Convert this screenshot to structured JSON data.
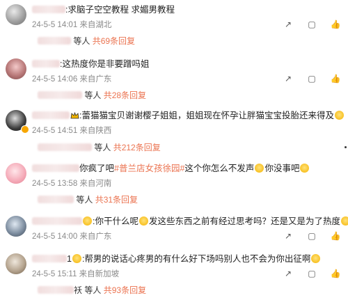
{
  "comments": [
    {
      "text": ":求脑子空空教程 求媚男教程",
      "date": "24-5-5 14:01",
      "location": "来自湖北",
      "sub_who": "等人",
      "sub_count": "共69条回复"
    },
    {
      "text": ":这热度你是非要蹭吗姐",
      "date": "24-5-5 14:06",
      "location": "来自广东",
      "sub_who": "等人",
      "sub_count": "共28条回复"
    },
    {
      "text": ":蕾猫猫宝贝谢谢樱子姐姐，姐姐现在怀孕让胖猫宝宝投胎还来得及",
      "date": "24-5-5 14:51",
      "location": "来自陕西",
      "sub_who": "等人",
      "sub_count": "共212条回复"
    },
    {
      "text_prefix": "你疯了吧",
      "topic": "#普兰店女孩徐园#",
      "text_suffix": "这个你怎么不发声",
      "text_tail": "你没事吧",
      "date": "24-5-5 13:58",
      "location": "来自河南",
      "sub_who": "等人",
      "sub_count": "共31条回复"
    },
    {
      "text_prefix": ":你干什么呢",
      "text_suffix": "发这些东西之前有经过思考吗？还是又是为了热度",
      "date": "24-5-5 14:00",
      "location": "来自广东",
      "sub_who": "等人",
      "sub_count": "共16条回复"
    },
    {
      "text_prefix": "1",
      "text_suffix": ":帮男的说话心疼男的有什么好下场吗别人也不会为你出征啊",
      "date": "24-5-5 15:11",
      "location": "来自新加坡",
      "sub_who_prefix": "袄",
      "sub_who": "等人",
      "sub_count": "共93条回复"
    }
  ],
  "icons": [
    "share-icon",
    "comment-icon",
    "like-icon"
  ],
  "colors": {
    "accent": "#eb7350",
    "meta": "#8a8a8a"
  }
}
